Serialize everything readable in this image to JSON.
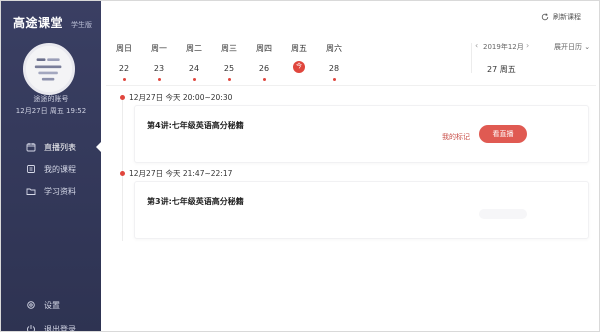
{
  "app": {
    "title": "高途课堂",
    "tag": "学生版"
  },
  "account": {
    "name": "途途的账号",
    "datetime": "12月27日 周五 19:52"
  },
  "nav": [
    {
      "label": "直播列表",
      "icon": "calendar-icon"
    },
    {
      "label": "我的课程",
      "icon": "book-icon"
    },
    {
      "label": "学习资料",
      "icon": "folder-icon"
    }
  ],
  "bottom_nav": [
    {
      "label": "设置",
      "icon": "gear-icon"
    },
    {
      "label": "退出登录",
      "icon": "power-icon"
    }
  ],
  "toolbar": {
    "refresh_label": "刷新课程"
  },
  "week": [
    {
      "name": "周日",
      "num": "22"
    },
    {
      "name": "周一",
      "num": "23"
    },
    {
      "name": "周二",
      "num": "24"
    },
    {
      "name": "周三",
      "num": "25"
    },
    {
      "name": "周四",
      "num": "26"
    },
    {
      "name": "周五",
      "num": "今"
    },
    {
      "name": "周六",
      "num": "28"
    }
  ],
  "calendar": {
    "month": "2019年12月",
    "expand_label": "展开日历",
    "selected": "27 周五"
  },
  "sessions": [
    {
      "header": "12月27日 今天 20:00~20:30",
      "title": "第4讲:七年级英语高分秘籍",
      "mark_label": "我的标记",
      "button": "看直播"
    },
    {
      "header": "12月27日 今天 21:47~22:17",
      "title": "第3讲:七年级英语高分秘籍"
    }
  ],
  "colors": {
    "accent": "#e0463d",
    "sidebar": "#353a5c"
  }
}
